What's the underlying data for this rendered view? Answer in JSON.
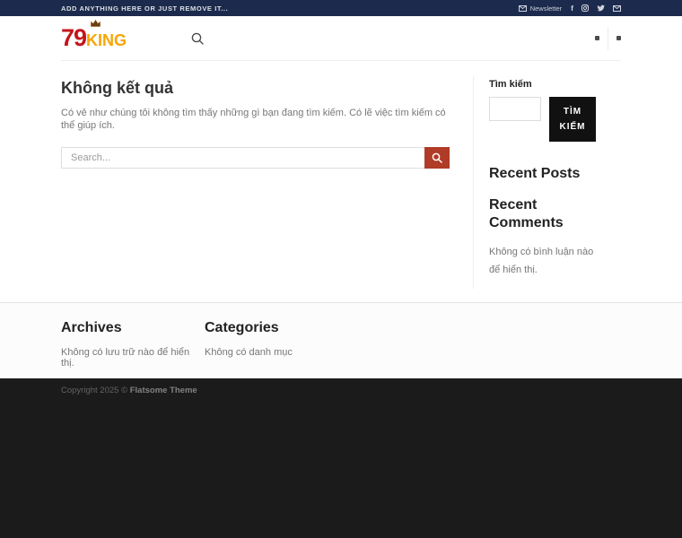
{
  "colors": {
    "topbar_bg": "#1c2b4d",
    "accent_red": "#b03b26",
    "logo_red": "#c3161c",
    "logo_gold": "#f7a500",
    "button_black": "#111111",
    "footer_dark_bg": "#1b1b1b"
  },
  "topbar": {
    "left_text": "ADD ANYTHING HERE OR JUST REMOVE IT...",
    "newsletter_label": "Newsletter",
    "icons": [
      "envelope-icon",
      "facebook-icon",
      "instagram-icon",
      "twitter-icon",
      "envelope-icon"
    ]
  },
  "header": {
    "logo_part1": "79",
    "logo_part2": "KING",
    "icons": [
      "crown-icon",
      "search-icon",
      "mini-icon",
      "mini-icon"
    ]
  },
  "main": {
    "title": "Không kết quả",
    "description": "Có vẻ như chúng tôi không tìm thấy những gì bạn đang tìm kiếm. Có lẽ việc tìm kiếm có thể giúp ích.",
    "search_placeholder": "Search...",
    "search_icon": "search-icon"
  },
  "sidebar": {
    "search_label": "Tìm kiếm",
    "search_button_label": "TÌM KIẾM",
    "recent_posts_title": "Recent Posts",
    "recent_comments_title": "Recent Comments",
    "no_comments_text": "Không có bình luận nào để hiển thị."
  },
  "footer": {
    "archives_title": "Archives",
    "archives_empty": "Không có lưu trữ nào để hiển thị.",
    "categories_title": "Categories",
    "categories_empty": "Không có danh mục",
    "copyright_prefix": "Copyright 2025 © ",
    "copyright_brand": "Flatsome Theme"
  }
}
